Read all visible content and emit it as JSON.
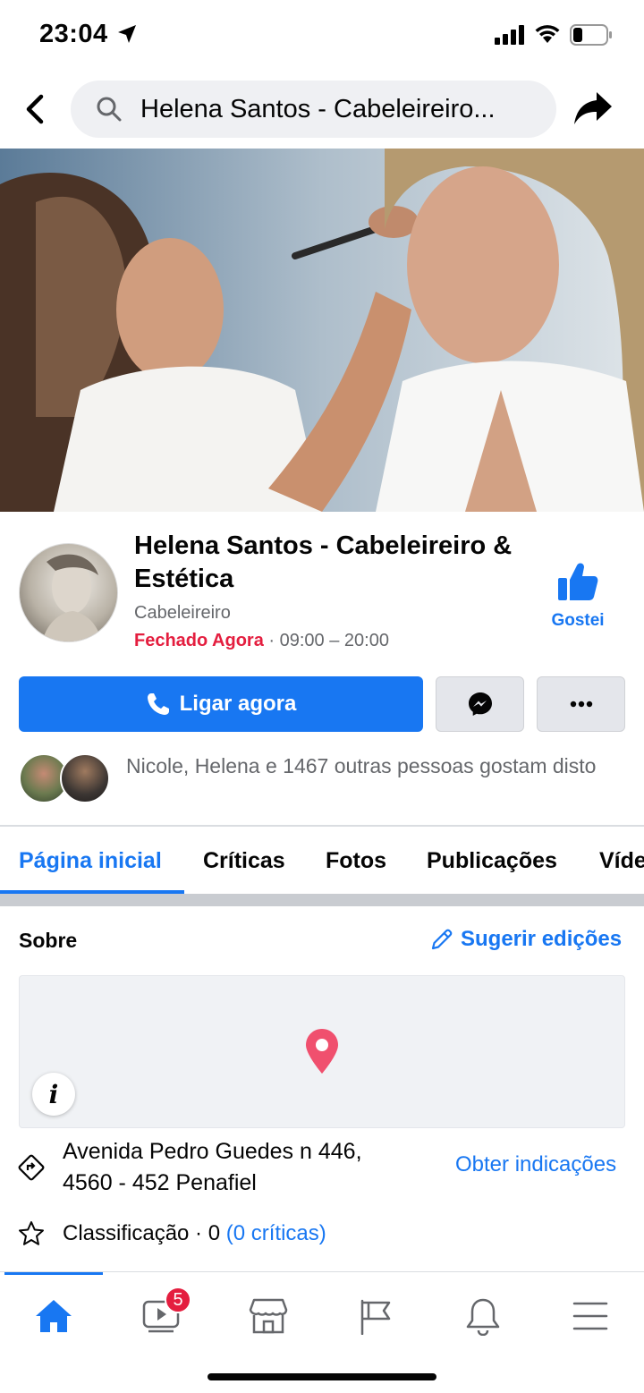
{
  "status_bar": {
    "time": "23:04",
    "icons": [
      "location-arrow-icon",
      "signal-icon",
      "wifi-icon",
      "battery-icon"
    ]
  },
  "top_nav": {
    "search_text": "Helena Santos - Cabeleireiro...",
    "icons": [
      "back-icon",
      "search-icon",
      "share-icon"
    ]
  },
  "page": {
    "name": "Helena Santos - Cabeleireiro & Estética",
    "category": "Cabeleireiro",
    "status": "Fechado Agora",
    "hours": " · 09:00 – 20:00",
    "like_label": "Gostei"
  },
  "actions": {
    "call_label": "Ligar agora",
    "icons": [
      "phone-icon",
      "messenger-icon",
      "more-icon"
    ]
  },
  "friends": {
    "text": "Nicole, Helena e 1467 outras pessoas gostam disto"
  },
  "tabs": [
    {
      "label": "Página inicial",
      "active": true
    },
    {
      "label": "Críticas",
      "active": false
    },
    {
      "label": "Fotos",
      "active": false
    },
    {
      "label": "Publicações",
      "active": false
    },
    {
      "label": "Víde",
      "active": false
    }
  ],
  "about": {
    "title": "Sobre",
    "suggest_label": "Sugerir edições",
    "address_line1": "Avenida Pedro Guedes n 446,",
    "address_line2": "4560 - 452 Penafiel",
    "directions_label": "Obter indicações",
    "rating_label": "Classificação · 0 ",
    "rating_link": "(0 críticas)"
  },
  "bottom_nav": {
    "items": [
      "home-icon",
      "watch-icon",
      "marketplace-icon",
      "pages-icon",
      "notifications-icon",
      "menu-icon"
    ],
    "watch_badge": "5"
  },
  "colors": {
    "accent": "#1877f2",
    "closed": "#e41e3f",
    "secondary_text": "#65676b",
    "map_pin": "#f0506e"
  }
}
